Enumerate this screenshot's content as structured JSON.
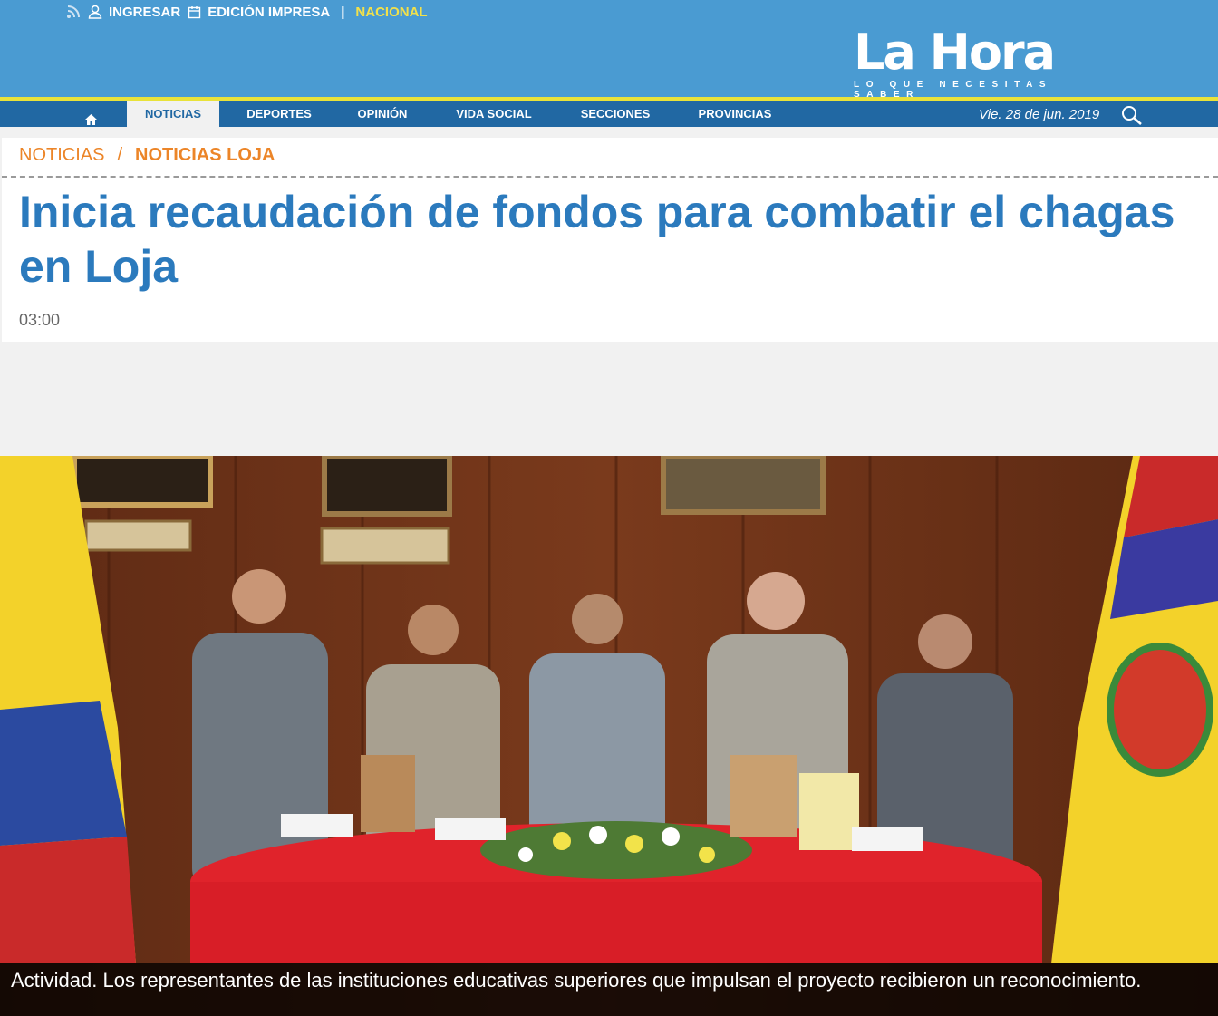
{
  "topbar": {
    "icons": [
      "rss-icon",
      "user-icon",
      "calendar-icon"
    ],
    "login_label": "INGRESAR",
    "print_label": "EDICIÓN IMPRESA",
    "separator": "|",
    "edition_label": "NACIONAL"
  },
  "logo": {
    "name": "La Hora",
    "tagline": "LO QUE NECESITAS SABER"
  },
  "nav": {
    "home_icon": "home-icon",
    "items": [
      {
        "label": "NOTICIAS",
        "active": true
      },
      {
        "label": "DEPORTES"
      },
      {
        "label": "OPINIÓN"
      },
      {
        "label": "VIDA SOCIAL"
      },
      {
        "label": "SECCIONES"
      },
      {
        "label": "PROVINCIAS"
      }
    ],
    "date": "Vie. 28 de jun. 2019",
    "search_icon": "search-icon"
  },
  "breadcrumb": {
    "parent": "NOTICIAS",
    "separator": "/",
    "current": "NOTICIAS LOJA"
  },
  "article": {
    "headline": "Inicia recaudación de fondos para combatir el chagas en Loja",
    "time": "03:00",
    "caption": "Actividad. Los representantes de las instituciones educativas superiores que impulsan el proyecto recibieron un reconocimiento."
  },
  "colors": {
    "header_blue": "#4a9bd2",
    "nav_blue": "#2168a3",
    "accent_yellow": "#e9e23a",
    "breadcrumb_orange": "#ec8528",
    "headline_blue": "#2b7abd"
  }
}
